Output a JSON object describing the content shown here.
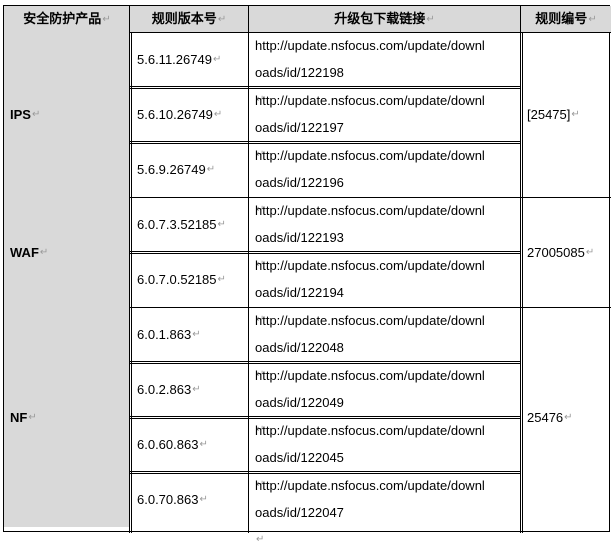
{
  "headers": {
    "product": "安全防护产品",
    "version": "规则版本号",
    "link": "升级包下载链接",
    "rule_id": "规则编号"
  },
  "mark": "↵",
  "groups": [
    {
      "product": "IPS",
      "rule_id": "[25475]",
      "rows": [
        {
          "version": "5.6.11.26749",
          "link_line1": "http://update.nsfocus.com/update/downl",
          "link_line2": "oads/id/122198"
        },
        {
          "version": "5.6.10.26749",
          "link_line1": "http://update.nsfocus.com/update/downl",
          "link_line2": "oads/id/122197"
        },
        {
          "version": "5.6.9.26749",
          "link_line1": "http://update.nsfocus.com/update/downl",
          "link_line2": "oads/id/122196"
        }
      ]
    },
    {
      "product": "WAF",
      "rule_id": "27005085",
      "rows": [
        {
          "version": "6.0.7.3.52185",
          "link_line1": "http://update.nsfocus.com/update/downl",
          "link_line2": "oads/id/122193"
        },
        {
          "version": "6.0.7.0.52185",
          "link_line1": "http://update.nsfocus.com/update/downl",
          "link_line2": "oads/id/122194"
        }
      ]
    },
    {
      "product": "NF",
      "rule_id": "25476",
      "rows": [
        {
          "version": "6.0.1.863",
          "link_line1": "http://update.nsfocus.com/update/downl",
          "link_line2": "oads/id/122048"
        },
        {
          "version": "6.0.2.863",
          "link_line1": "http://update.nsfocus.com/update/downl",
          "link_line2": "oads/id/122049"
        },
        {
          "version": "6.0.60.863",
          "link_line1": "http://update.nsfocus.com/update/downl",
          "link_line2": "oads/id/122045"
        },
        {
          "version": "6.0.70.863",
          "link_line1": "http://update.nsfocus.com/update/downl",
          "link_line2": "oads/id/122047"
        }
      ]
    }
  ]
}
